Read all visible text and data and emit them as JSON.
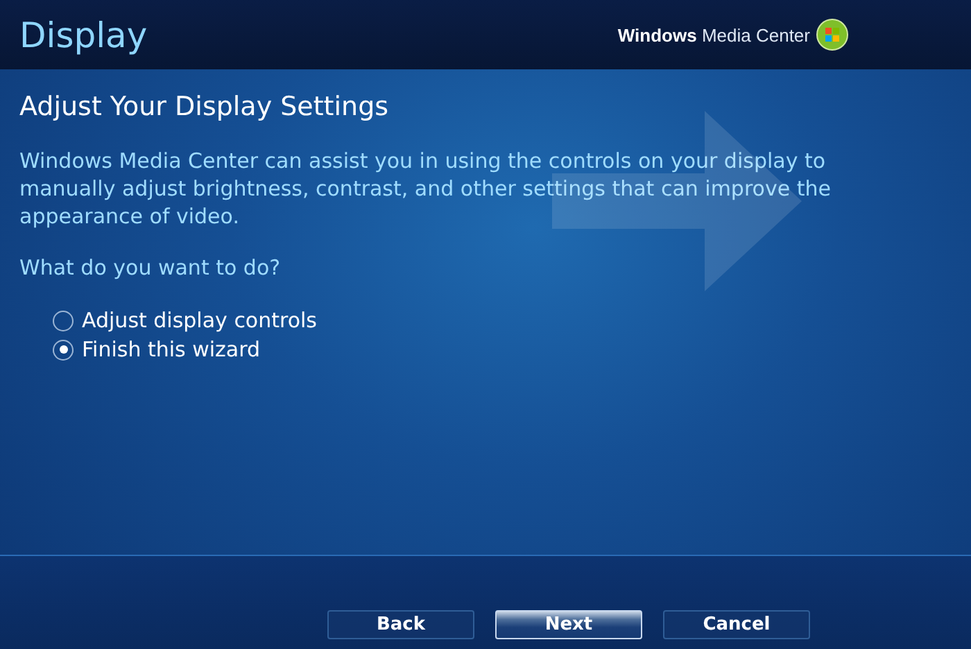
{
  "header": {
    "title": "Display",
    "brand": "**Windows** Media Center"
  },
  "heading": "Adjust Your Display Settings",
  "description": "Windows Media Center can assist you in using the controls on your display to manually adjust brightness, contrast, and other settings that can improve the appearance of video.",
  "question": "What do you want to do?",
  "options": [
    {
      "label": "Adjust display controls",
      "selected": false
    },
    {
      "label": "Finish this wizard",
      "selected": true
    }
  ],
  "buttons": [
    {
      "label": "Back",
      "focused": false
    },
    {
      "label": "Next",
      "focused": true
    },
    {
      "label": "Cancel",
      "focused": false
    }
  ]
}
